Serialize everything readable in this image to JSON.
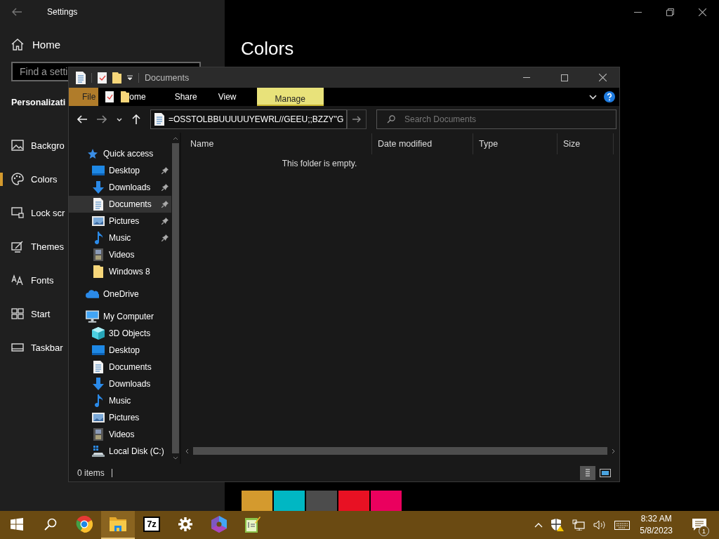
{
  "settings": {
    "title": "Settings",
    "home": "Home",
    "search": {
      "placeholder": "Find a setti"
    },
    "section": "Personalizati",
    "items": [
      {
        "label": "Backgro",
        "kind": "picture",
        "selected": false
      },
      {
        "label": "Colors",
        "kind": "palette",
        "selected": true
      },
      {
        "label": "Lock scr",
        "kind": "lock",
        "selected": false
      },
      {
        "label": "Themes",
        "kind": "theme",
        "selected": false
      },
      {
        "label": "Fonts",
        "kind": "fonts",
        "selected": false
      },
      {
        "label": "Start",
        "kind": "start",
        "selected": false
      },
      {
        "label": "Taskbar",
        "kind": "taskbar",
        "selected": false
      }
    ],
    "page_title": "Colors",
    "swatches": [
      {
        "color": "#d49a2e"
      },
      {
        "color": "#00b7c3"
      },
      {
        "color": "#4c4c4c"
      },
      {
        "color": "#e81123"
      },
      {
        "color": "#ea005e"
      }
    ]
  },
  "explorer": {
    "title": "Documents",
    "tabs": [
      {
        "label": "File",
        "kind": "file",
        "selected": false
      },
      {
        "label": "ome",
        "kind": "home",
        "selected": false
      },
      {
        "label": "Share",
        "kind": "plain",
        "selected": false
      },
      {
        "label": "View",
        "kind": "plain",
        "selected": false
      },
      {
        "label": "Manage",
        "kind": "contextual",
        "selected": true
      }
    ],
    "address": "=OSSTOLBBUUUUUYEWRL//GEEU;;BZZY''G",
    "search": {
      "placeholder": "Search Documents"
    },
    "nav": [
      {
        "label": "Quick access",
        "kind": "star",
        "selected": false,
        "children": [
          {
            "label": "Desktop",
            "kind": "desktop",
            "pinned": true,
            "selected": false
          },
          {
            "label": "Downloads",
            "kind": "downloads",
            "pinned": true,
            "selected": false
          },
          {
            "label": "Documents",
            "kind": "documents",
            "pinned": true,
            "selected": true
          },
          {
            "label": "Pictures",
            "kind": "pictures",
            "pinned": true,
            "selected": false
          },
          {
            "label": "Music",
            "kind": "music",
            "pinned": true,
            "selected": false
          },
          {
            "label": "Videos",
            "kind": "videos",
            "pinned": false,
            "selected": false
          },
          {
            "label": "Windows 8",
            "kind": "folder",
            "pinned": false,
            "selected": false
          }
        ]
      },
      {
        "label": "OneDrive",
        "kind": "cloud",
        "selected": false
      },
      {
        "label": "My Computer",
        "kind": "computer",
        "selected": false,
        "children": [
          {
            "label": "3D Objects",
            "kind": "cube",
            "pinned": false,
            "selected": false
          },
          {
            "label": "Desktop",
            "kind": "desktop",
            "pinned": false,
            "selected": false
          },
          {
            "label": "Documents",
            "kind": "documents",
            "pinned": false,
            "selected": false
          },
          {
            "label": "Downloads",
            "kind": "downloads",
            "pinned": false,
            "selected": false
          },
          {
            "label": "Music",
            "kind": "music",
            "pinned": false,
            "selected": false
          },
          {
            "label": "Pictures",
            "kind": "pictures",
            "pinned": false,
            "selected": false
          },
          {
            "label": "Videos",
            "kind": "videos",
            "pinned": false,
            "selected": false
          },
          {
            "label": "Local Disk (C:)",
            "kind": "disk",
            "pinned": false,
            "selected": false
          }
        ]
      }
    ],
    "columns": [
      "Name",
      "Date modified",
      "Type",
      "Size"
    ],
    "empty_message": "This folder is empty.",
    "status": "0 items"
  },
  "taskbar": {
    "apps": [
      {
        "kind": "start"
      },
      {
        "kind": "search"
      },
      {
        "kind": "browser"
      },
      {
        "kind": "explorer",
        "active": true
      },
      {
        "kind": "archiver",
        "label": "7z"
      },
      {
        "kind": "gear"
      },
      {
        "kind": "cube"
      },
      {
        "kind": "notepad"
      }
    ],
    "time": "8:32 AM",
    "date": "5/8/2023",
    "notifications": "1"
  }
}
